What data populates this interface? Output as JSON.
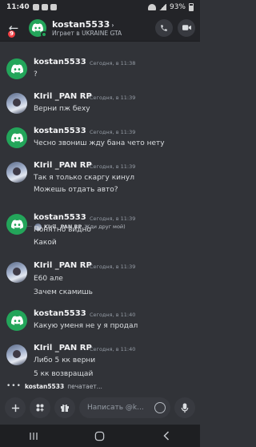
{
  "status_bar": {
    "time": "11:40",
    "battery": "93%"
  },
  "header": {
    "badge_count": "9",
    "title": "kostan5533",
    "chevron": "›",
    "subtitle": "Играет в UKRAINE GTA"
  },
  "messages": [
    {
      "author": "kostan5533",
      "time": "Сегодня, в 11:38",
      "avatar": "discord-green",
      "lines": [
        "?"
      ]
    },
    {
      "author": "KIril _PAN RP",
      "time": "Сегодня, в 11:39",
      "avatar": "photo",
      "lines": [
        "Верни пж беху"
      ]
    },
    {
      "author": "kostan5533",
      "time": "Сегодня, в 11:39",
      "avatar": "discord-green",
      "lines": [
        "Чесно звониш жду бана чето нету"
      ]
    },
    {
      "author": "KIril _PAN RP",
      "time": "Сегодня, в 11:39",
      "avatar": "photo",
      "lines": [
        "Так я только скаргу кинул",
        "Можешь отдать авто?"
      ]
    },
    {
      "author": "kostan5533",
      "time": "Сегодня, в 11:39",
      "avatar": "discord-green",
      "lines": [
        "Понятно видно",
        "Какой"
      ],
      "reply_to": {
        "author": "KIril _PAN RP",
        "text": "Жди друг мой)"
      }
    },
    {
      "author": "KIril _PAN RP",
      "time": "Сегодня, в 11:39",
      "avatar": "photo",
      "lines": [
        "E60 але",
        "Зачем скамишь"
      ]
    },
    {
      "author": "kostan5533",
      "time": "Сегодня, в 11:40",
      "avatar": "discord-green",
      "lines": [
        "Какую уменя не у я продал"
      ]
    },
    {
      "author": "KIril _PAN RP",
      "time": "Сегодня, в 11:40",
      "avatar": "photo",
      "lines": [
        "Либо 5 кк верни",
        "5 кк возвращай"
      ]
    }
  ],
  "typing": {
    "dots": "•••",
    "user": "kostan5533",
    "text": "печатает..."
  },
  "composer": {
    "placeholder": "Написать @k..."
  },
  "colors": {
    "background": "#313338",
    "bar": "#232428",
    "brand_green": "#23a55a",
    "badge_red": "#f23f43"
  },
  "icons": [
    "back-arrow-icon",
    "discord-logo-icon",
    "call-icon",
    "video-call-icon",
    "plus-icon",
    "apps-icon",
    "gift-icon",
    "emoji-icon",
    "microphone-icon",
    "recent-apps-icon",
    "home-icon",
    "back-icon"
  ]
}
